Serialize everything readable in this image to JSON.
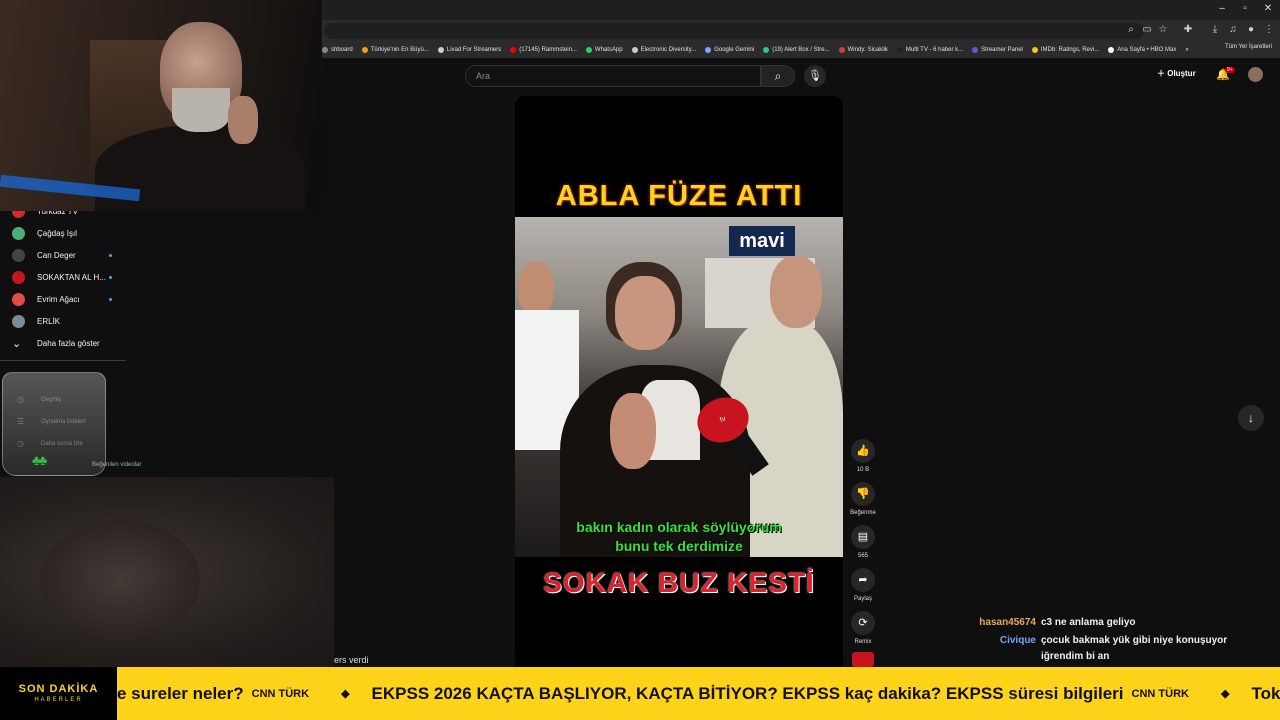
{
  "browser": {
    "bookmarks": [
      {
        "label": "shboard",
        "color": "#888888"
      },
      {
        "label": "Türkiye'nin En Büyü...",
        "color": "#e8a317"
      },
      {
        "label": "Livad For Streamers",
        "color": "#cccccc"
      },
      {
        "label": "(17145) Rammstein...",
        "color": "#ff0000"
      },
      {
        "label": "WhatsApp",
        "color": "#25d366"
      },
      {
        "label": "Electronic Diversity...",
        "color": "#cccccc"
      },
      {
        "label": "Google Gemini",
        "color": "#7aa7ff"
      },
      {
        "label": "(19) Alert Box / Stre...",
        "color": "#31c48d"
      },
      {
        "label": "Windy: Sicaklik",
        "color": "#d43b3b"
      },
      {
        "label": "Multi TV - 6 haber k...",
        "color": "#222222"
      },
      {
        "label": "Streamer Panel",
        "color": "#5b5bd6"
      },
      {
        "label": "IMDb: Ratings, Revi...",
        "color": "#f5c518"
      },
      {
        "label": "Ana Sayfa • HBO Max",
        "color": "#ffffff"
      }
    ],
    "bookmarks_more": "»",
    "all_bookmarks": "Tüm Yer İşaretleri"
  },
  "youtube": {
    "search_placeholder": "Ara",
    "create_label": "Oluştur",
    "notification_count": "9+"
  },
  "sidebar": {
    "items": [
      {
        "label": "Turkuaz TV",
        "color": "#d62b2b",
        "dot": false
      },
      {
        "label": "Çağdaş Işıl",
        "color": "#4caf78",
        "dot": false
      },
      {
        "label": "Can Deger",
        "color": "#444444",
        "dot": true
      },
      {
        "label": "SOKAKTAN AL H...",
        "color": "#c8141e",
        "dot": true
      },
      {
        "label": "Evrim Ağacı",
        "color": "#e34b4b",
        "dot": true
      },
      {
        "label": "ERLİK",
        "color": "#7a8a99",
        "dot": false
      },
      {
        "label": "Daha fazla göster",
        "color": "",
        "dot": false
      }
    ],
    "glass_items": [
      "Geçmiş",
      "Oynatma listeleri",
      "Daha sonra izle"
    ],
    "glass_extra": "Beğenilen videolar"
  },
  "short": {
    "headline": "ABLA FÜZE ATTI",
    "store_sign": "mavi",
    "mic_label": "tv",
    "caption_line1": "bakın kadın olarak söylüyorum",
    "caption_line2": "bunu tek derdimize",
    "footline": "SOKAK BUZ KESTİ",
    "actions": {
      "like_count": "10 B",
      "dislike_label": "Beğenme",
      "comments_count": "565",
      "share_label": "Paylaş",
      "remix_label": "Remix"
    }
  },
  "overlay_partial_text": "ers verdi",
  "chat": [
    {
      "user": "hasan45674",
      "user_color": "#e8a95c",
      "message": "c3 ne anlama geliyo"
    },
    {
      "user": "Civique",
      "user_color": "#6fa8ff",
      "message": "çocuk bakmak yük gibi niye konuşuyor"
    },
    {
      "user": "",
      "user_color": "",
      "message": "iğrendim bi an"
    }
  ],
  "ticker": {
    "brand_line1": "SON DAKİKA",
    "brand_line2": "HABERLER",
    "items": [
      {
        "text": "e sureler neler?",
        "source": "CNN TÜRK"
      },
      {
        "text": "EKPSS 2026 KAÇTA BAŞLIYOR, KAÇTA BİTİYOR? EKPSS kaç dakika? EKPSS süresi bilgileri",
        "source": "CNN TÜRK"
      },
      {
        "text": "Tokat'",
        "source": ""
      }
    ],
    "separator": "◆"
  }
}
